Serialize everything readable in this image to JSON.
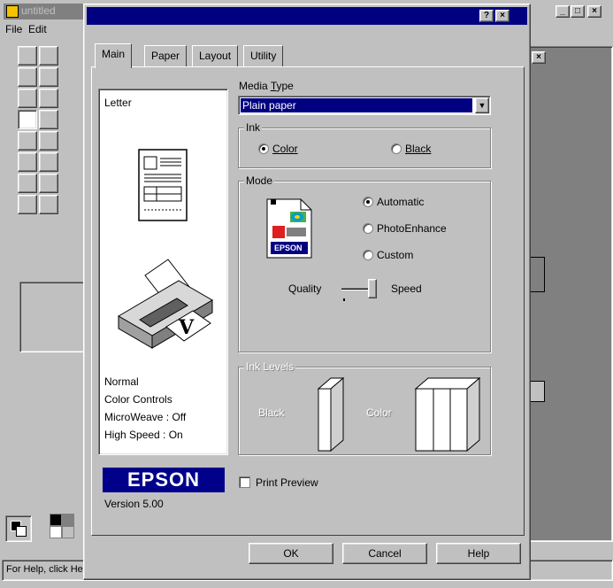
{
  "paint": {
    "title": "untitled",
    "menu": [
      "File",
      "Edit"
    ],
    "status_text": "For Help, click Help Topics on the Help menu.",
    "tools": [
      "free-select-icon",
      "select-icon",
      "eraser-icon",
      "fill-icon",
      "eyedropper-icon",
      "magnifier-icon",
      "pencil-icon",
      "brush-icon",
      "airbrush-icon",
      "text-icon",
      "line-icon",
      "curve-icon",
      "rectangle-icon",
      "polygon-icon",
      "ellipse-icon",
      "rounded-rect-icon"
    ]
  },
  "dialog": {
    "tabs": [
      "Main",
      "Paper",
      "Layout",
      "Utility"
    ],
    "preview": {
      "paper": "Letter",
      "info": [
        "Normal",
        "Color Controls",
        "MicroWeave : Off",
        "High Speed : On"
      ]
    },
    "media_type": {
      "label": "Media Type",
      "value": "Plain paper"
    },
    "ink": {
      "title": "Ink",
      "options": [
        "Color",
        "Black"
      ],
      "selected": "Color"
    },
    "mode": {
      "title": "Mode",
      "options": [
        "Automatic",
        "PhotoEnhance",
        "Custom"
      ],
      "selected": "Automatic",
      "quality_label": "Quality",
      "speed_label": "Speed",
      "epson_badge": "EPSON"
    },
    "ink_levels": {
      "title": "Ink Levels",
      "black_label": "Black",
      "color_label": "Color"
    },
    "logo": "EPSON",
    "version": "Version 5.00",
    "print_preview": "Print Preview",
    "buttons": {
      "ok": "OK",
      "cancel": "Cancel",
      "help": "Help"
    }
  }
}
